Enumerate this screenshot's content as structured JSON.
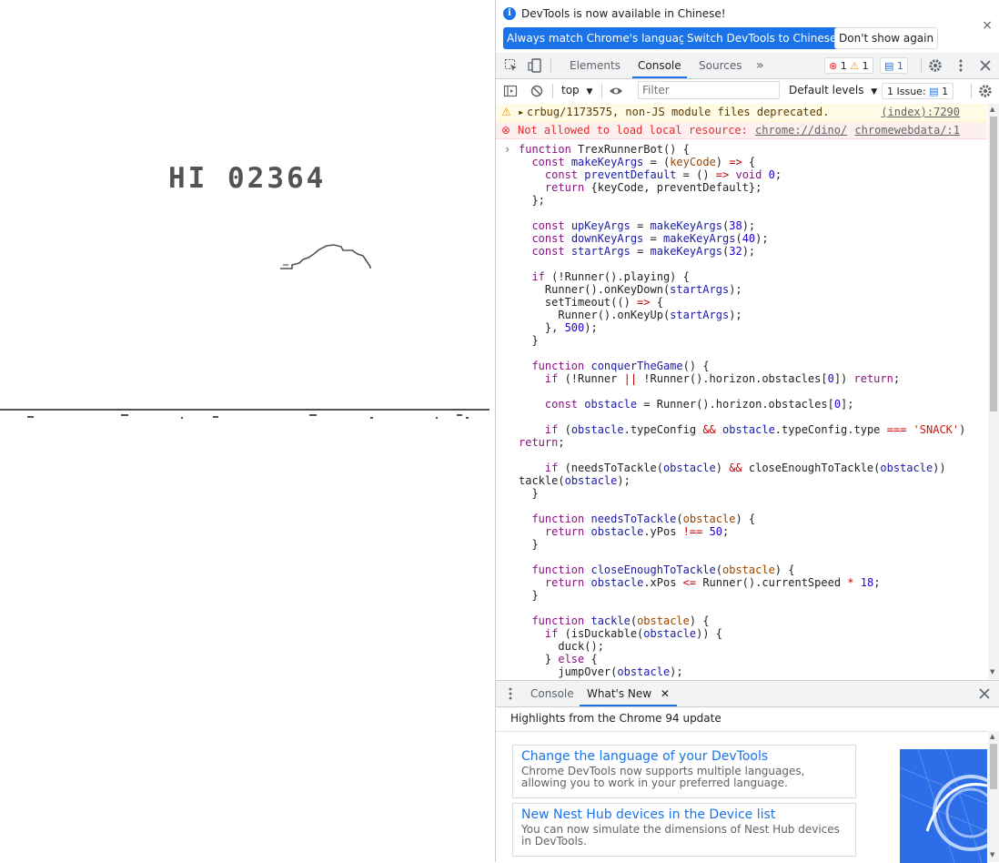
{
  "game": {
    "hi_score": "HI 02364"
  },
  "infobar": {
    "message": "DevTools is now available in Chinese!",
    "btn_match": "Always match Chrome's language",
    "btn_switch": "Switch DevTools to Chinese",
    "btn_dont": "Don't show again",
    "close": "×"
  },
  "tabs": {
    "elements": "Elements",
    "console": "Console",
    "sources": "Sources",
    "more": "»",
    "errors": "1",
    "warnings": "1",
    "info": "1"
  },
  "toolbar": {
    "context": "top",
    "filter_placeholder": "Filter",
    "levels": "Default levels",
    "issues": "1 Issue:",
    "issues_count": "1"
  },
  "messages": {
    "warning_text": "crbug/1173575, non-JS module files deprecated.",
    "warning_src": "(index):7290",
    "error_text": "Not allowed to load local resource:",
    "error_url": "chrome://dino/",
    "error_src": "chromewebdata/:1"
  },
  "drawer": {
    "tab_console": "Console",
    "tab_whatsnew": "What's New",
    "title": "Highlights from the Chrome 94 update",
    "cards": [
      {
        "title": "Change the language of your DevTools",
        "desc": "Chrome DevTools now supports multiple languages, allowing you to work in your preferred language."
      },
      {
        "title": "New Nest Hub devices in the Device list",
        "desc": "You can now simulate the dimensions of Nest Hub devices in DevTools."
      }
    ]
  },
  "colors": {
    "accent": "#1a73e8",
    "game_gray": "#535353",
    "warning_bg": "#fffbe5",
    "error_bg": "#fff0f0"
  }
}
